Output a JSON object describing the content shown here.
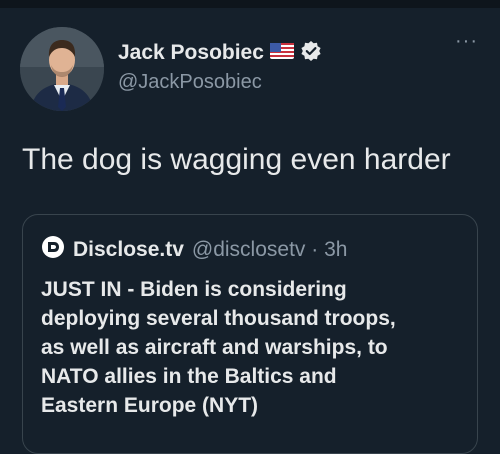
{
  "author": {
    "display_name": "Jack Posobiec",
    "handle": "@JackPosobiec",
    "flag_icon": "us-flag-icon",
    "verified_icon": "verified-badge-icon"
  },
  "tweet": {
    "text": "The dog is wagging even harder",
    "more_label": "···"
  },
  "quote": {
    "source_name": "Disclose.tv",
    "handle_time": "@disclosetv · 3h",
    "text_lines": [
      "JUST IN - Biden is considering",
      "deploying several thousand troops,",
      "as well as aircraft and warships, to",
      "NATO allies in the Baltics and",
      "Eastern Europe (NYT)"
    ]
  },
  "colors": {
    "background": "#15202b",
    "text_primary": "#e7e9ea",
    "text_secondary": "#8b98a5",
    "border": "#38444d"
  }
}
